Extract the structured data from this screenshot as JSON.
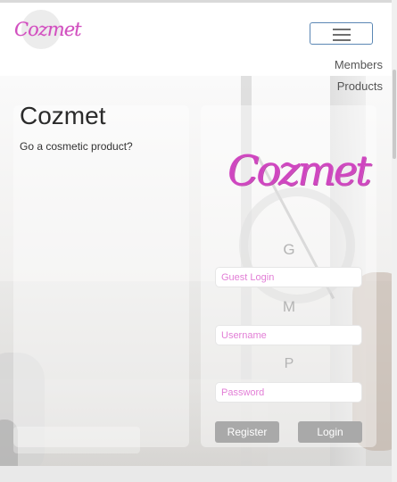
{
  "brand": {
    "logo_text": "Cozmet",
    "color": "#d14fbf"
  },
  "nav": {
    "menu_toggle_icon": "hamburger-icon",
    "links": [
      {
        "label": "Members"
      },
      {
        "label": "Products"
      }
    ]
  },
  "hero": {
    "title": "Cozmet",
    "subtitle": "Go a cosmetic product?"
  },
  "login": {
    "logo_text": "Cozmet",
    "guest": {
      "icon_glyph": "G",
      "icon_name": "guest-icon",
      "placeholder": "Guest Login"
    },
    "username": {
      "icon_glyph": "M",
      "icon_name": "member-icon",
      "placeholder": "Username"
    },
    "password": {
      "icon_glyph": "P",
      "icon_name": "password-icon",
      "placeholder": "Password"
    },
    "buttons": {
      "register": "Register",
      "login": "Login"
    }
  },
  "colors": {
    "accent": "#d14fbf",
    "button_bg": "#a9a9a9",
    "toggle_border": "#5b87b4"
  }
}
